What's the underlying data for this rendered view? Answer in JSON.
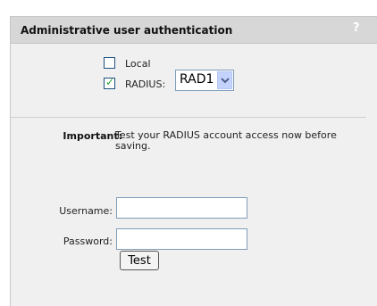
{
  "panel": {
    "title": "Administrative user authentication",
    "help_glyph": "?"
  },
  "auth": {
    "local": {
      "label": "Local",
      "checked": false
    },
    "radius": {
      "label": "RADIUS:",
      "checked": true,
      "server_selected": "RAD1"
    }
  },
  "notice": {
    "label": "Important:",
    "text": "Test your RADIUS account access now before saving."
  },
  "form": {
    "username_label": "Username:",
    "username_value": "",
    "password_label": "Password:",
    "password_value": "",
    "test_label": "Test"
  },
  "colors": {
    "header_bg": "#d7d7d7",
    "panel_bg": "#f0f0f0",
    "checkmark": "#21a121"
  }
}
